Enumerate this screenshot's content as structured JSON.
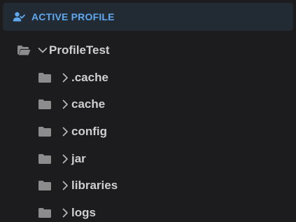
{
  "header": {
    "title": "ACTIVE PROFILE",
    "icon": "user-check-icon",
    "title_color": "#5fa8f0"
  },
  "tree": {
    "root": {
      "label": "ProfileTest",
      "expanded": true
    },
    "children": [
      {
        "label": ".cache",
        "expanded": false
      },
      {
        "label": "cache",
        "expanded": false
      },
      {
        "label": "config",
        "expanded": false
      },
      {
        "label": "jar",
        "expanded": false
      },
      {
        "label": "libraries",
        "expanded": false
      },
      {
        "label": "logs",
        "expanded": false
      }
    ]
  }
}
